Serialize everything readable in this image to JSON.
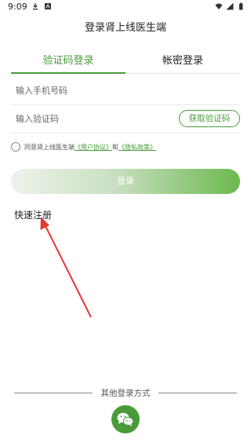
{
  "status_bar": {
    "time": "9:09"
  },
  "page": {
    "title": "登录肾上线医生端"
  },
  "tabs": [
    {
      "label": "验证码登录",
      "active": true
    },
    {
      "label": "帐密登录",
      "active": false
    }
  ],
  "form": {
    "phone_placeholder": "输入手机号码",
    "code_placeholder": "输入验证码",
    "get_code_label": "获取验证码"
  },
  "agreement": {
    "prefix": "同意肾上线医生端",
    "user_agreement": "《用户协议》",
    "and": "和",
    "privacy_policy": "《隐私政策》"
  },
  "login_button": "登录",
  "register_link": "快速注册",
  "other_login": {
    "label": "其他登录方式"
  },
  "colors": {
    "accent": "#4a9a3c",
    "annotation_arrow": "#e53935"
  },
  "icons": [
    "download-icon",
    "notification-icon",
    "wifi-icon",
    "signal-icon",
    "battery-icon",
    "wechat-icon"
  ]
}
